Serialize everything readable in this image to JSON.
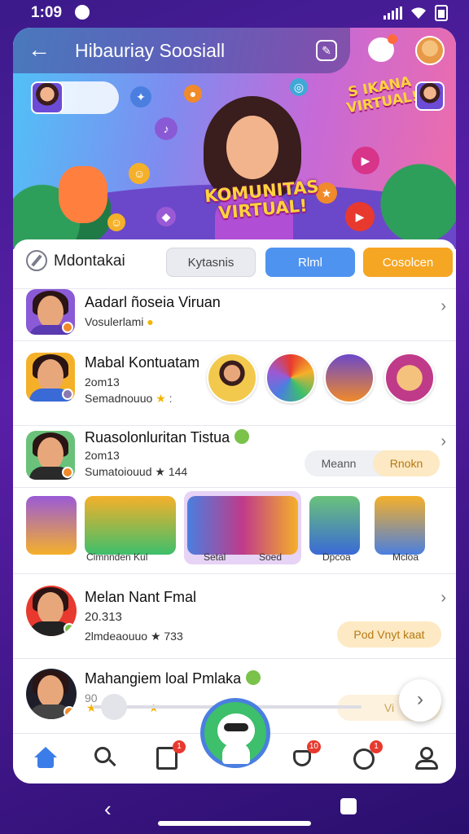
{
  "status_bar": {
    "time": "1:09"
  },
  "header": {
    "title": "Hibauriay Soosiall"
  },
  "hero": {
    "title": "KOMUNITAS VIRTUAL!",
    "badge": "S IKANA VIRTUAL!"
  },
  "tabs": {
    "section_label": "Mdontakai",
    "chips": [
      "Kytasnis",
      "Rlml",
      "Cosolcen"
    ]
  },
  "rows": [
    {
      "title": "Aadarl ñoseia Viruan",
      "subtitle": "Vosulerlami"
    },
    {
      "title": "Mabal Kontuatam",
      "line2": "2om13",
      "line3": "Semadnouuo"
    },
    {
      "title": "Ruasolonluritan Tistua",
      "line2": "2om13",
      "line3": "Sumatoiouud ★ 144",
      "seg": [
        "Meann",
        "Rnokn"
      ]
    },
    {
      "title": "Melan Nant Fmal",
      "line2": "20.313",
      "line3": "2lmdeaouuo ★ 733",
      "pill": "Pod Vnyt kaat"
    },
    {
      "title": "Mahangiem loal Pmlaka",
      "line2": "90",
      "line3": "Vi"
    }
  ],
  "stories": {
    "captions": [
      "Cimnnden Kul",
      "Setal",
      "Soed",
      "Dpcoa",
      "Mcloa"
    ]
  },
  "bottom_nav": {
    "items": [
      "home-icon",
      "search-icon",
      "feed-icon",
      "profile-mascot",
      "likes-icon",
      "messages-icon",
      "profile-icon"
    ],
    "badges": {
      "feed": "1",
      "likes": "10",
      "messages": "1"
    }
  },
  "colors": {
    "accent_blue": "#4f93f0",
    "accent_orange": "#f5a623",
    "verified_green": "#7ac24a"
  }
}
